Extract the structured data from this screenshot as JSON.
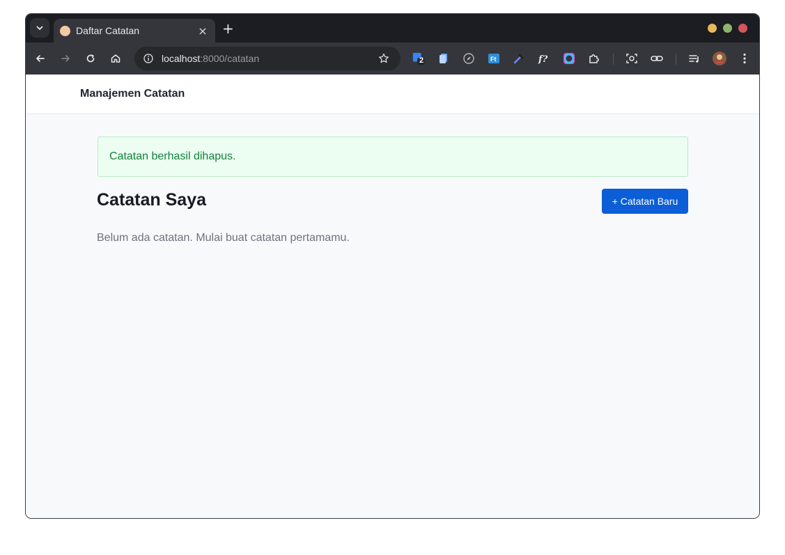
{
  "browser": {
    "tab": {
      "title": "Daftar Catatan",
      "favicon_glyph": "🐶",
      "close_glyph": "×"
    },
    "new_tab_glyph": "+",
    "tab_list_glyph": "⌄",
    "traffic_lights": [
      "#e6b958",
      "#8db46a",
      "#d5555d"
    ],
    "address": {
      "host": "localhost",
      "path": ":8000/catatan"
    },
    "extension_badge": "2",
    "icons": [
      "back-icon",
      "forward-icon",
      "reload-icon",
      "home-icon",
      "site-info-icon",
      "bookmark-star-icon",
      "extensions-puzzle-icon",
      "screenshot-icon",
      "link-icon",
      "media-queue-icon",
      "profile-avatar",
      "more-menu-icon"
    ]
  },
  "page": {
    "brand": "Manajemen Catatan",
    "alert": "Catatan berhasil dihapus.",
    "heading": "Catatan Saya",
    "new_button": "+ Catatan Baru",
    "empty_message": "Belum ada catatan. Mulai buat catatan pertamamu."
  },
  "colors": {
    "primary": "#0b5ed7",
    "success_text": "#15803d",
    "success_bg": "#ecfdf1"
  }
}
